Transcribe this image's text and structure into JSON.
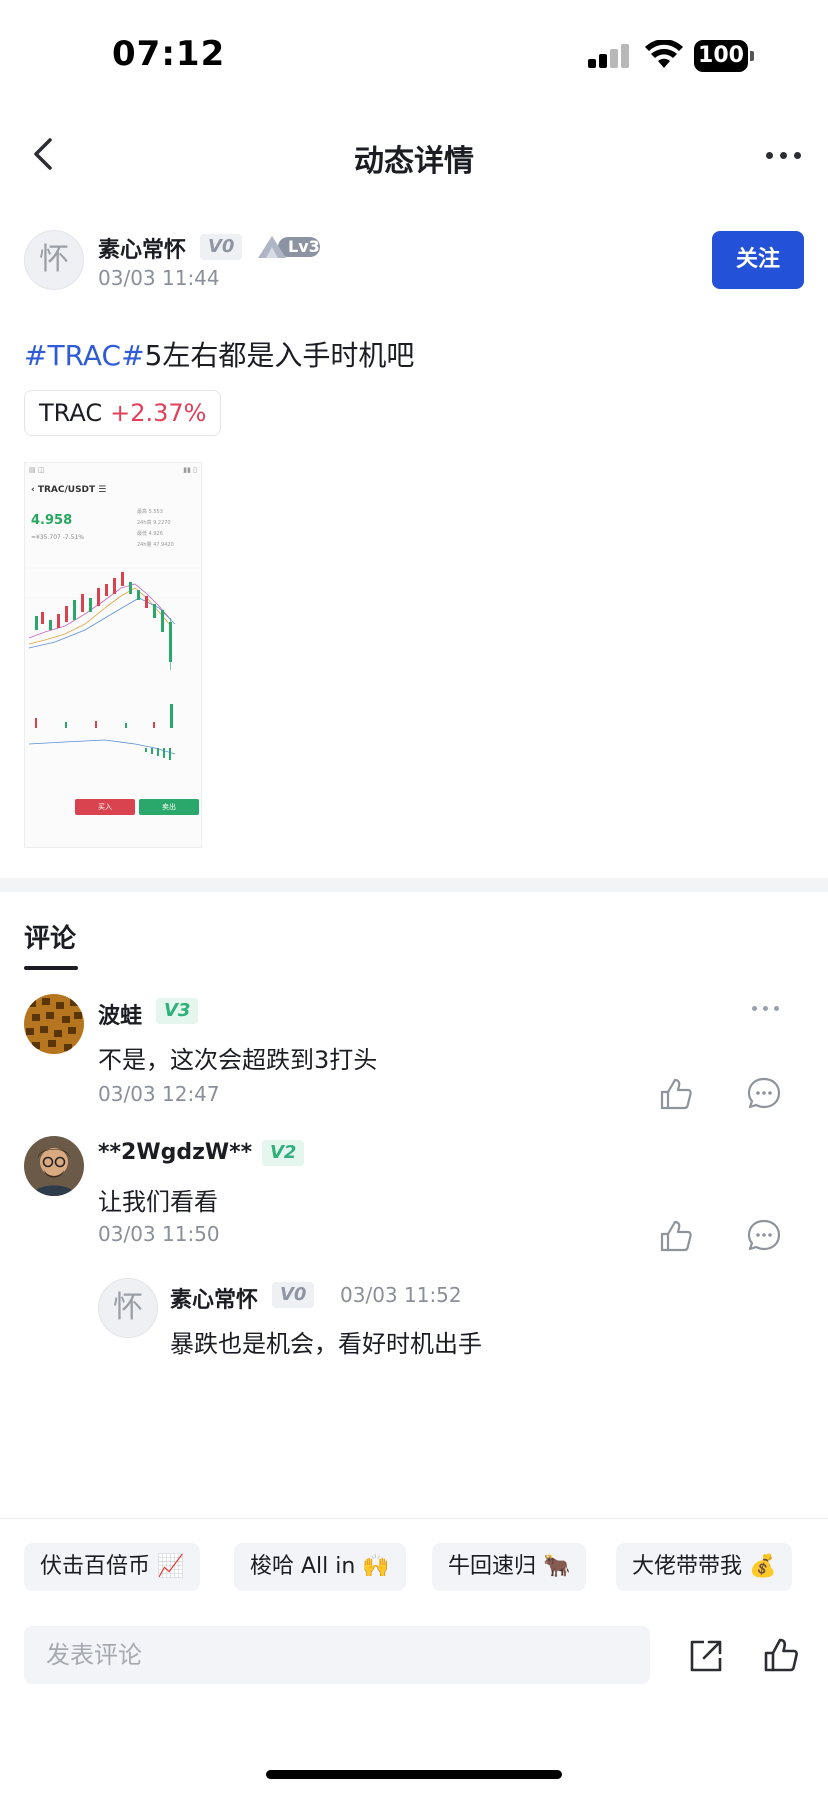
{
  "status_bar": {
    "time": "07:12",
    "battery": "100"
  },
  "nav": {
    "title": "动态详情"
  },
  "author": {
    "avatar_char": "怀",
    "name": "素心常怀",
    "vip": "V0",
    "level": "Lv3",
    "time": "03/03 11:44",
    "follow_label": "关注"
  },
  "post": {
    "hashtag": "#TRAC#",
    "text": "5左右都是入手时机吧",
    "ticker": {
      "symbol": "TRAC",
      "change": "+2.37%",
      "change_color": "#e0405a"
    },
    "thumbnail": {
      "pair": "TRAC/USDT ☰",
      "price": "4.958",
      "sub": "≈¥35.707  -7.51%",
      "stats": [
        "最高 5.553",
        "24h高 9.2270",
        "最低 4.926",
        "24h量 47.9420"
      ],
      "buy": "买入",
      "sell": "卖出"
    }
  },
  "comments": {
    "tab_label": "评论",
    "items": [
      {
        "name": "波蛙",
        "vip": "V3",
        "text": "不是，这次会超跌到3打头",
        "time": "03/03 12:47"
      },
      {
        "name": "**2WgdzW**",
        "vip": "V2",
        "text": "让我们看看",
        "time": "03/03 11:50",
        "reply": {
          "avatar_char": "怀",
          "name": "素心常怀",
          "vip": "V0",
          "time": "03/03 11:52",
          "text": "暴跌也是机会，看好时机出手"
        }
      }
    ]
  },
  "quick_replies": [
    "伏击百倍币 📈",
    "梭哈 All in 🙌",
    "牛回速归 🐂",
    "大佬带带我 💰"
  ],
  "input": {
    "placeholder": "发表评论"
  },
  "colors": {
    "accent": "#2352d8",
    "hashtag": "#2f5bd8",
    "up": "#25a760",
    "down": "#d9434f"
  }
}
